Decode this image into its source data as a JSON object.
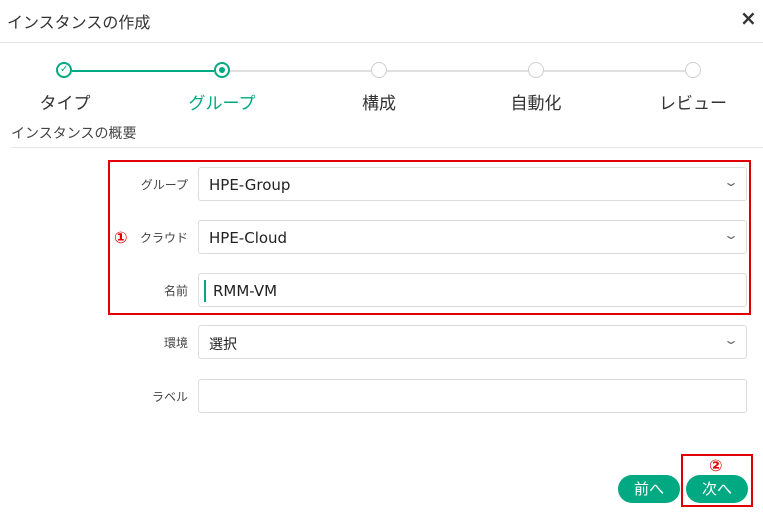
{
  "dialog": {
    "title": "インスタンスの作成",
    "close_icon": "×"
  },
  "steps": [
    {
      "label": "タイプ",
      "state": "done"
    },
    {
      "label": "グループ",
      "state": "active"
    },
    {
      "label": "構成",
      "state": "pending"
    },
    {
      "label": "自動化",
      "state": "pending"
    },
    {
      "label": "レビュー",
      "state": "pending"
    }
  ],
  "section": {
    "title": "インスタンスの概要"
  },
  "form": {
    "group": {
      "label": "グループ",
      "value": "HPE-Group"
    },
    "cloud": {
      "label": "クラウド",
      "value": "HPE-Cloud"
    },
    "name": {
      "label": "名前",
      "value": "RMM-VM"
    },
    "environment": {
      "label": "環境",
      "value": "選択"
    },
    "labels": {
      "label": "ラベル",
      "value": ""
    }
  },
  "annotations": {
    "marker1": "①",
    "marker2": "②"
  },
  "buttons": {
    "prev": "前へ",
    "next": "次へ"
  },
  "colors": {
    "accent": "#01a982",
    "highlight": "#e00000"
  }
}
